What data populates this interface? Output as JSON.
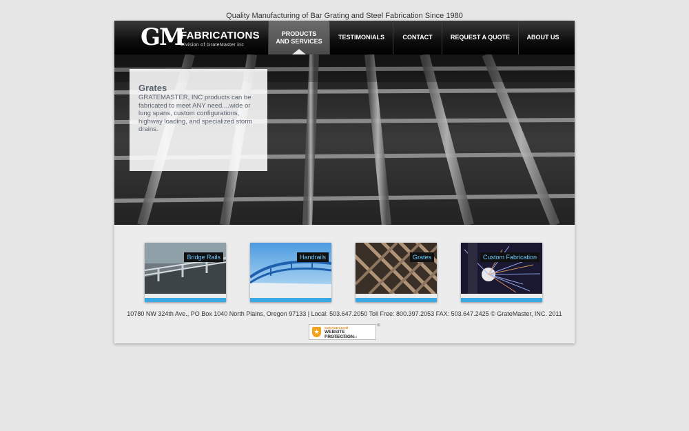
{
  "tagline": "Quality Manufacturing of Bar Grating and Steel Fabrication Since 1980",
  "logo": {
    "mark": "GM",
    "name": "FABRICATIONS",
    "subtitle": "Division of GrateMaster inc"
  },
  "nav": {
    "items": [
      {
        "label_line1": "PRODUCTS",
        "label_line2": "AND SERVICES",
        "active": true
      },
      {
        "label_line1": "TESTIMONIALS",
        "label_line2": ""
      },
      {
        "label_line1": "CONTACT",
        "label_line2": ""
      },
      {
        "label_line1": "REQUEST A QUOTE",
        "label_line2": ""
      },
      {
        "label_line1": "ABOUT US",
        "label_line2": ""
      }
    ]
  },
  "hero": {
    "title": "Grates",
    "text": "GRATEMASTER, INC products can be fabricated to meet ANY need....wide or long spans, custom configurations, highway loading, and specialized storm drains."
  },
  "thumbnails": [
    {
      "label": "Bridge Rails"
    },
    {
      "label": "Handrails"
    },
    {
      "label": "Grates"
    },
    {
      "label": "Custom Fabrication"
    }
  ],
  "footer": {
    "text": "10780 NW 324th Ave., PO Box 1040 North Plains, Oregon 97133 | Local: 503.647.2050 Toll Free: 800.397.2053 FAX: 503.647.2425 © GrateMaster, INC. 2011"
  },
  "badge": {
    "top": "GODADDY.COM",
    "main": "WEBSITE PROTECTION",
    "date": "TESTED 2012-06-24",
    "close": "⊠"
  },
  "colors": {
    "accent": "#3aa9e3",
    "label_text": "#6cc7ff",
    "hero_text": "#5a6370"
  }
}
